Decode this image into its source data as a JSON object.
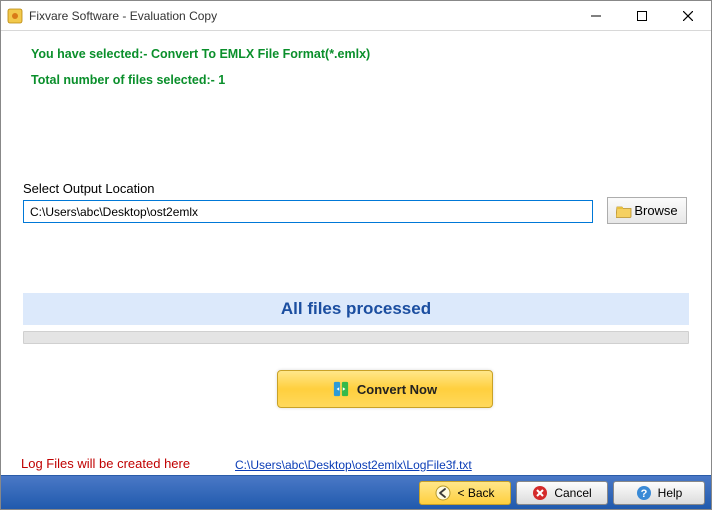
{
  "window": {
    "title": "Fixvare Software - Evaluation Copy"
  },
  "info": {
    "line1": "You have selected:- Convert To EMLX File Format(*.emlx)",
    "line2": "Total number of files selected:- 1"
  },
  "output": {
    "label": "Select Output Location",
    "path": "C:\\Users\\abc\\Desktop\\ost2emlx",
    "browse_label": "Browse"
  },
  "status": {
    "message": "All files processed"
  },
  "actions": {
    "convert_label": "Convert Now"
  },
  "log": {
    "label": "Log Files will be created here",
    "link_text": "C:\\Users\\abc\\Desktop\\ost2emlx\\LogFile3f.txt"
  },
  "footer": {
    "back_label": "< Back",
    "cancel_label": "Cancel",
    "help_label": "Help"
  },
  "colors": {
    "accent_green": "#0a8f2b",
    "status_bg": "#dce9fb",
    "status_text": "#1b4ea0",
    "log_red": "#c00000",
    "link_blue": "#0b3db6"
  }
}
